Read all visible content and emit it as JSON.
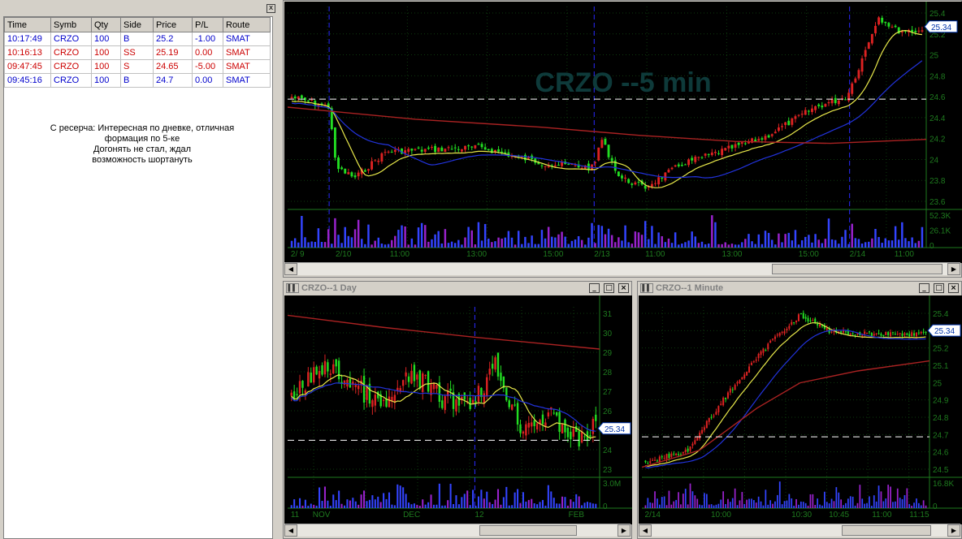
{
  "trade_log": {
    "close_label": "x",
    "columns": [
      "Time",
      "Symb",
      "Qty",
      "Side",
      "Price",
      "P/L",
      "Route"
    ],
    "rows": [
      {
        "time": "10:17:49",
        "symb": "CRZO",
        "qty": "100",
        "side": "B",
        "price": "25.2",
        "pl": "-1.00",
        "route": "SMAT",
        "color": "blue"
      },
      {
        "time": "10:16:13",
        "symb": "CRZO",
        "qty": "100",
        "side": "SS",
        "price": "25.19",
        "pl": "0.00",
        "route": "SMAT",
        "color": "red"
      },
      {
        "time": "09:47:45",
        "symb": "CRZO",
        "qty": "100",
        "side": "S",
        "price": "24.65",
        "pl": "-5.00",
        "route": "SMAT",
        "color": "red"
      },
      {
        "time": "09:45:16",
        "symb": "CRZO",
        "qty": "100",
        "side": "B",
        "price": "24.7",
        "pl": "0.00",
        "route": "SMAT",
        "color": "blue"
      }
    ],
    "note_lines": [
      "С ресерча: Интересная по дневке, отличная",
      "формация по 5-ке",
      "Догонять не стал, ждал",
      "возможность шортануть"
    ]
  },
  "colors": {
    "chart_bg": "#000000",
    "grid": "#0d3a0d",
    "axis_text": "#1e7a1e",
    "candle_up": "#22dd22",
    "candle_down": "#dd2222",
    "ma_fast": "#e8e84a",
    "ma_mid": "#2233dd",
    "ma_slow": "#aa2222",
    "volume": "#3344ff",
    "volume_alt": "#9922cc",
    "watermark": "#0e3a3a",
    "price_tag_bg": "#ffffff",
    "price_tag_text": "#0033aa"
  },
  "charts": {
    "five_min": {
      "watermark": "CRZO --5 min",
      "price_tag": "25.34",
      "y_ticks": [
        "25.4",
        "25.2",
        "25",
        "24.8",
        "24.6",
        "24.4",
        "24.2",
        "24",
        "23.8",
        "23.6"
      ],
      "vol_ticks": [
        "52.3K",
        "26.1K",
        "0"
      ],
      "x_labels": [
        "2/ 9",
        "2/10",
        "11:00",
        "13:00",
        "15:00",
        "2/13",
        "11:00",
        "13:00",
        "15:00",
        "2/14",
        "11:00"
      ]
    },
    "one_day": {
      "title": "CRZO--1 Day",
      "price_tag": "25.34",
      "y_ticks": [
        "31",
        "30",
        "29",
        "28",
        "27",
        "26",
        "25",
        "24",
        "23"
      ],
      "vol_ticks": [
        "3.0M",
        "0"
      ],
      "x_labels": [
        "11",
        "NOV",
        "DEC",
        "12",
        "FEB"
      ]
    },
    "one_min": {
      "title": "CRZO--1 Minute",
      "price_tag": "25.34",
      "y_ticks": [
        "25.4",
        "25.3",
        "25.2",
        "25.1",
        "25",
        "24.9",
        "24.8",
        "24.7",
        "24.6",
        "24.5"
      ],
      "vol_ticks": [
        "16.8K",
        "0"
      ],
      "x_labels": [
        "2/14",
        "10:00",
        "10:30",
        "10:45",
        "11:00",
        "11:15"
      ]
    }
  },
  "window_buttons": {
    "minimize": "_",
    "maximize": "□",
    "close": "×"
  }
}
